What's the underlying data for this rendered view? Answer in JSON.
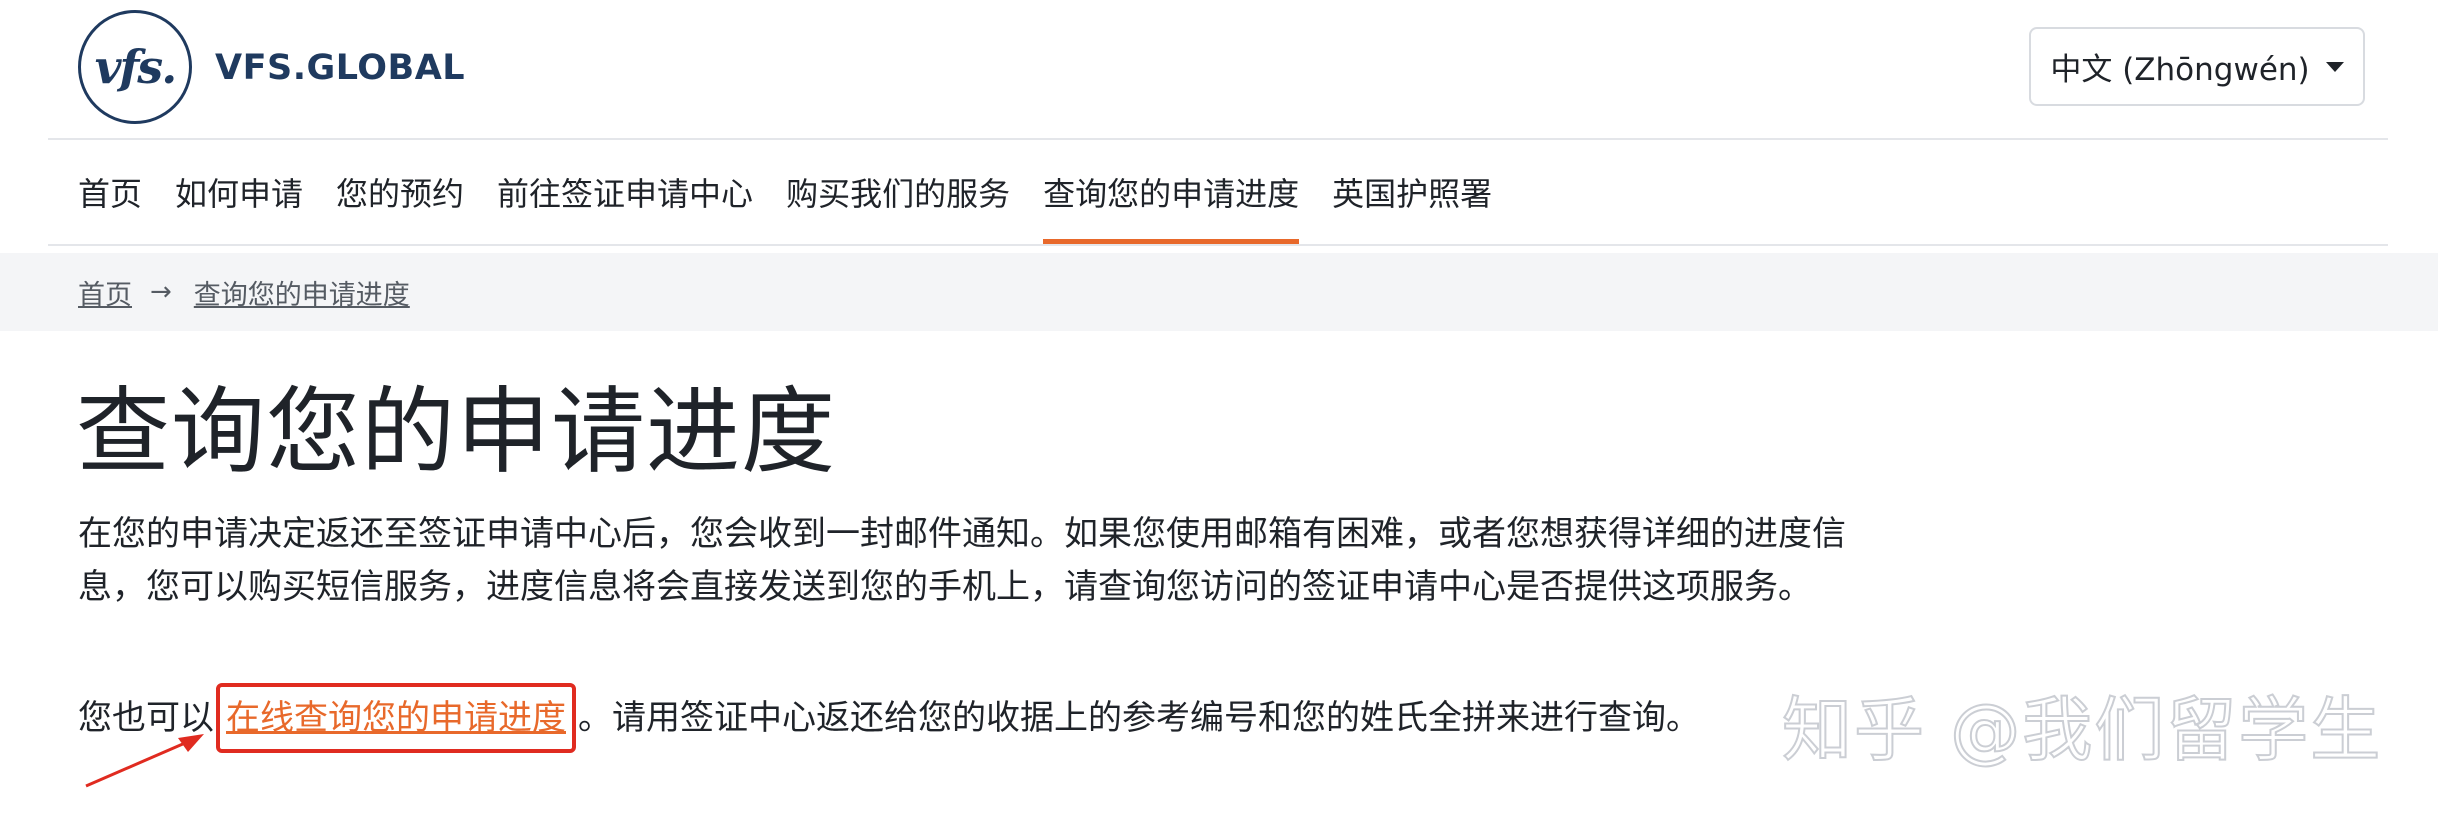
{
  "header": {
    "logo_mark": "vfs.",
    "logo_text": "VFS.GLOBAL",
    "language": "中文 (Zhōngwén)"
  },
  "nav": {
    "items": [
      {
        "label": "首页"
      },
      {
        "label": "如何申请"
      },
      {
        "label": "您的预约"
      },
      {
        "label": "前往签证申请中心"
      },
      {
        "label": "购买我们的服务"
      },
      {
        "label": "查询您的申请进度",
        "active": true
      },
      {
        "label": "英国护照署"
      }
    ]
  },
  "breadcrumb": {
    "home": "首页",
    "current": "查询您的申请进度"
  },
  "main": {
    "title": "查询您的申请进度",
    "paragraph1": "在您的申请决定返还至签证申请中心后，您会收到一封邮件通知。如果您使用邮箱有困难，或者您想获得详细的进度信息，您可以购买短信服务，进度信息将会直接发送到您的手机上，请查询您访问的签证申请中心是否提供这项服务。",
    "paragraph2_before": "您也可以",
    "paragraph2_link": "在线查询您的申请进度",
    "paragraph2_after": "。请用签证中心返还给您的收据上的参考编号和您的姓氏全拼来进行查询。"
  },
  "watermark": "知乎 @我们留学生",
  "colors": {
    "accent": "#e8692b",
    "annotation": "#e02b20",
    "brand": "#1f3a5f"
  }
}
